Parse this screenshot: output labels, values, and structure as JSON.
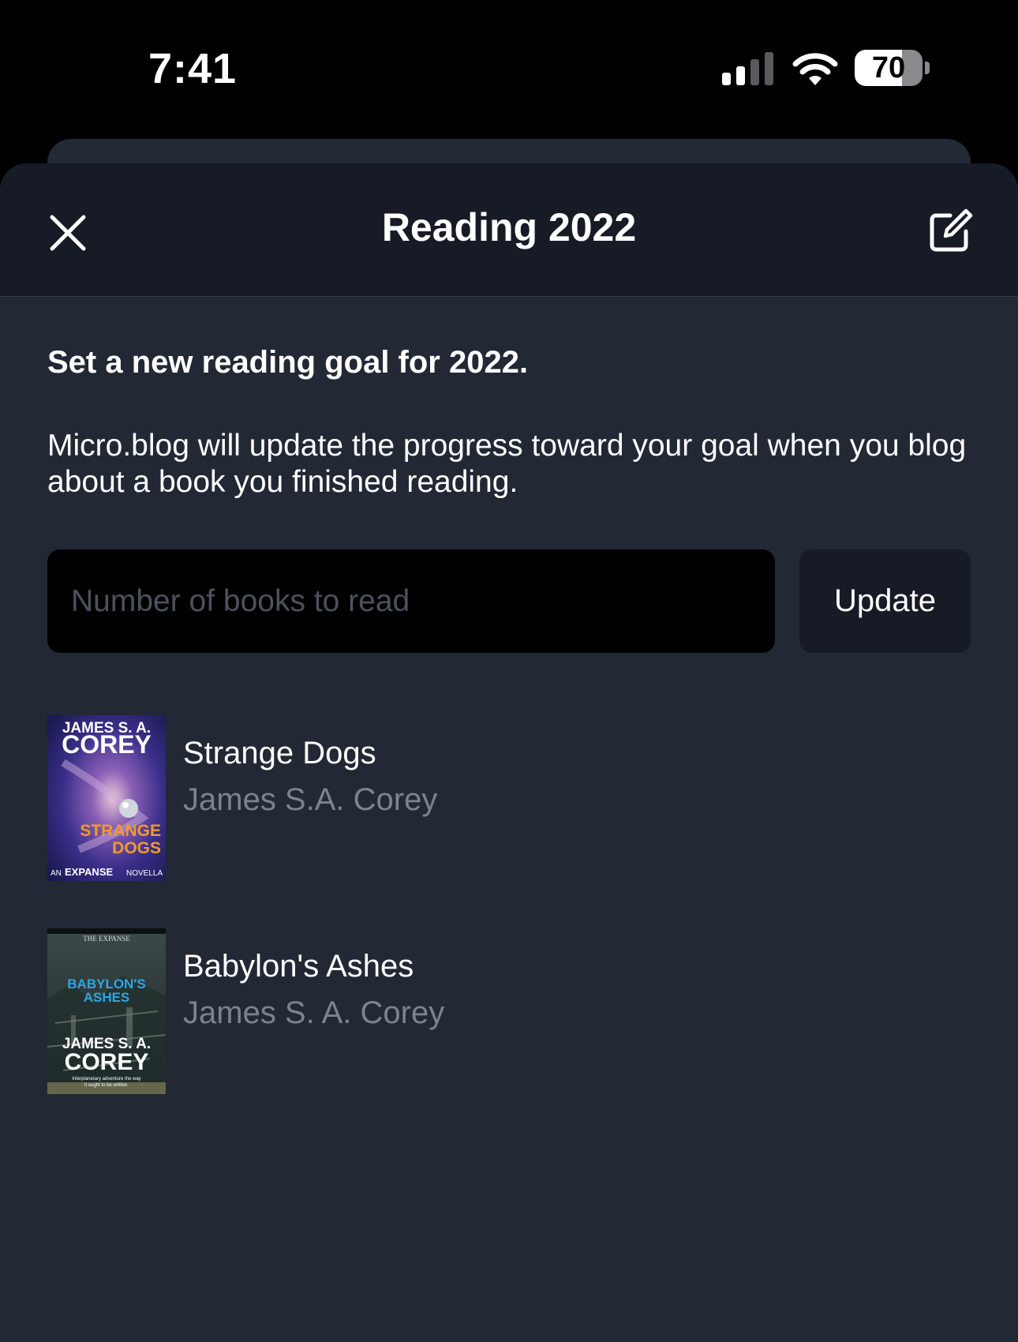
{
  "status_bar": {
    "time": "7:41",
    "battery_level": 70,
    "battery_label": "70"
  },
  "header": {
    "title": "Reading 2022",
    "close_icon": "close-x",
    "edit_icon": "compose-square"
  },
  "goal": {
    "heading": "Set a new reading goal for 2022.",
    "description": "Micro.blog will update the progress toward your goal when you blog about a book you finished reading.",
    "input_value": "",
    "input_placeholder": "Number of books to read",
    "update_label": "Update"
  },
  "books": [
    {
      "title": "Strange Dogs",
      "author": "James S.A. Corey",
      "cover": {
        "author_line1": "JAMES S. A.",
        "author_line2": "COREY",
        "title_line1": "STRANGE",
        "title_line2": "DOGS",
        "footer_pre": "AN",
        "footer_main": "EXPANSE",
        "footer_post": "NOVELLA"
      }
    },
    {
      "title": "Babylon's Ashes",
      "author": "James S. A. Corey",
      "cover": {
        "series": "THE EXPANSE",
        "title_line1": "BABYLON'S",
        "title_line2": "ASHES",
        "author_line1": "JAMES S. A.",
        "author_line2": "COREY",
        "blurb_line1": "Interplanetary adventure the way",
        "blurb_line2": "it ought to be written."
      }
    }
  ],
  "colors": {
    "background": "#000000",
    "sheet": "#222834",
    "header": "#161b25",
    "input": "#000000",
    "secondary_text": "#7d838c",
    "cover_orange": "#f29a2e",
    "cover_blue": "#2aa8e6"
  }
}
